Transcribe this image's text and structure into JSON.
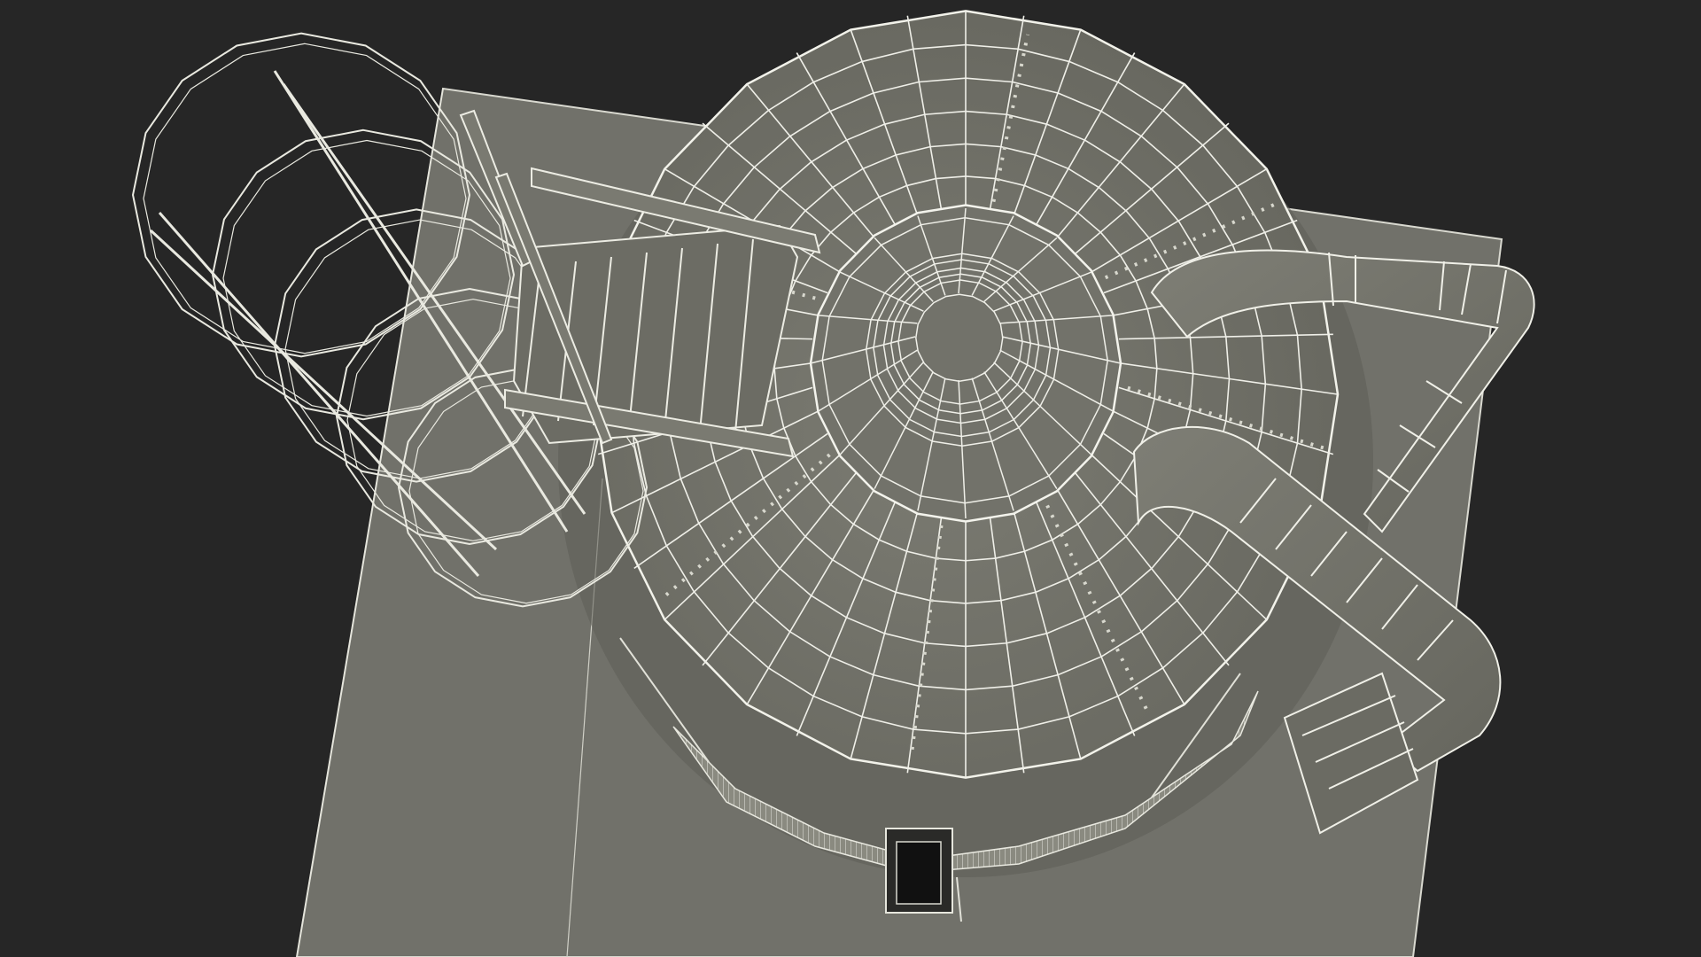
{
  "scene": {
    "background_color": "#262626",
    "surface_color": "#74746b",
    "surface_shadow_color": "#5f5f57",
    "wire_color": "#efefe8",
    "wire_dim_color": "#cfcfc6",
    "structure_dark_color": "#4b4b45",
    "subject": "wireframe-render-grain-silo-top-view"
  }
}
